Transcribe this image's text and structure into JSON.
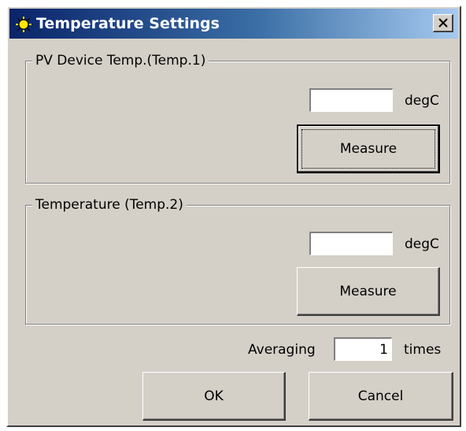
{
  "window": {
    "title": "Temperature Settings",
    "icon": "sun-icon"
  },
  "temp1": {
    "legend": "PV Device Temp.(Temp.1)",
    "value": "",
    "unit": "degC",
    "measure_label": "Measure"
  },
  "temp2": {
    "legend": "Temperature (Temp.2)",
    "value": "",
    "unit": "degC",
    "measure_label": "Measure"
  },
  "averaging": {
    "label": "Averaging",
    "value": "1",
    "unit": "times"
  },
  "buttons": {
    "ok_label": "OK",
    "cancel_label": "Cancel"
  },
  "colors": {
    "titlebar_start": "#0a246a",
    "titlebar_end": "#a6caf0",
    "face": "#d4d0c8"
  }
}
